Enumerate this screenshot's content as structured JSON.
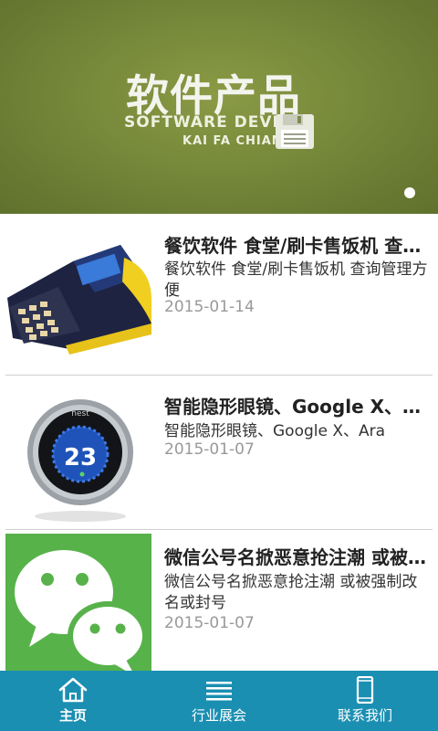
{
  "banner": {
    "title": "软件产品",
    "subtitle_line1": "SOFTWARE DEVE",
    "subtitle_line2": "KAI FA CHIAN",
    "icon": "floppy-disk-icon"
  },
  "articles": [
    {
      "title": "餐饮软件 食堂/刷卡售饭机 查询管理方便",
      "summary": "餐饮软件 食堂/刷卡售饭机 查询管理方便",
      "date": "2015-01-14",
      "thumbnail": "card-reader-image"
    },
    {
      "title": "智能隐形眼镜、Google X、Ara",
      "summary": "智能隐形眼镜、Google X、Ara",
      "date": "2015-01-07",
      "thumbnail": "thermostat-image",
      "thumbnail_text": {
        "brand": "nest",
        "reading": "23"
      }
    },
    {
      "title": "微信公号名掀恶意抢注潮 或被强制改名或封号",
      "summary": "微信公号名掀恶意抢注潮 或被强制改名或封号",
      "date": "2015-01-07",
      "thumbnail": "wechat-logo-image"
    }
  ],
  "nav": {
    "items": [
      {
        "label": "主页",
        "icon": "home-icon",
        "active": true
      },
      {
        "label": "行业展会",
        "icon": "list-icon",
        "active": false
      },
      {
        "label": "联系我们",
        "icon": "phone-icon",
        "active": false
      }
    ]
  },
  "colors": {
    "nav_background": "#1b8fb2",
    "banner_background": "#76883a",
    "wechat_green": "#57b24a"
  }
}
